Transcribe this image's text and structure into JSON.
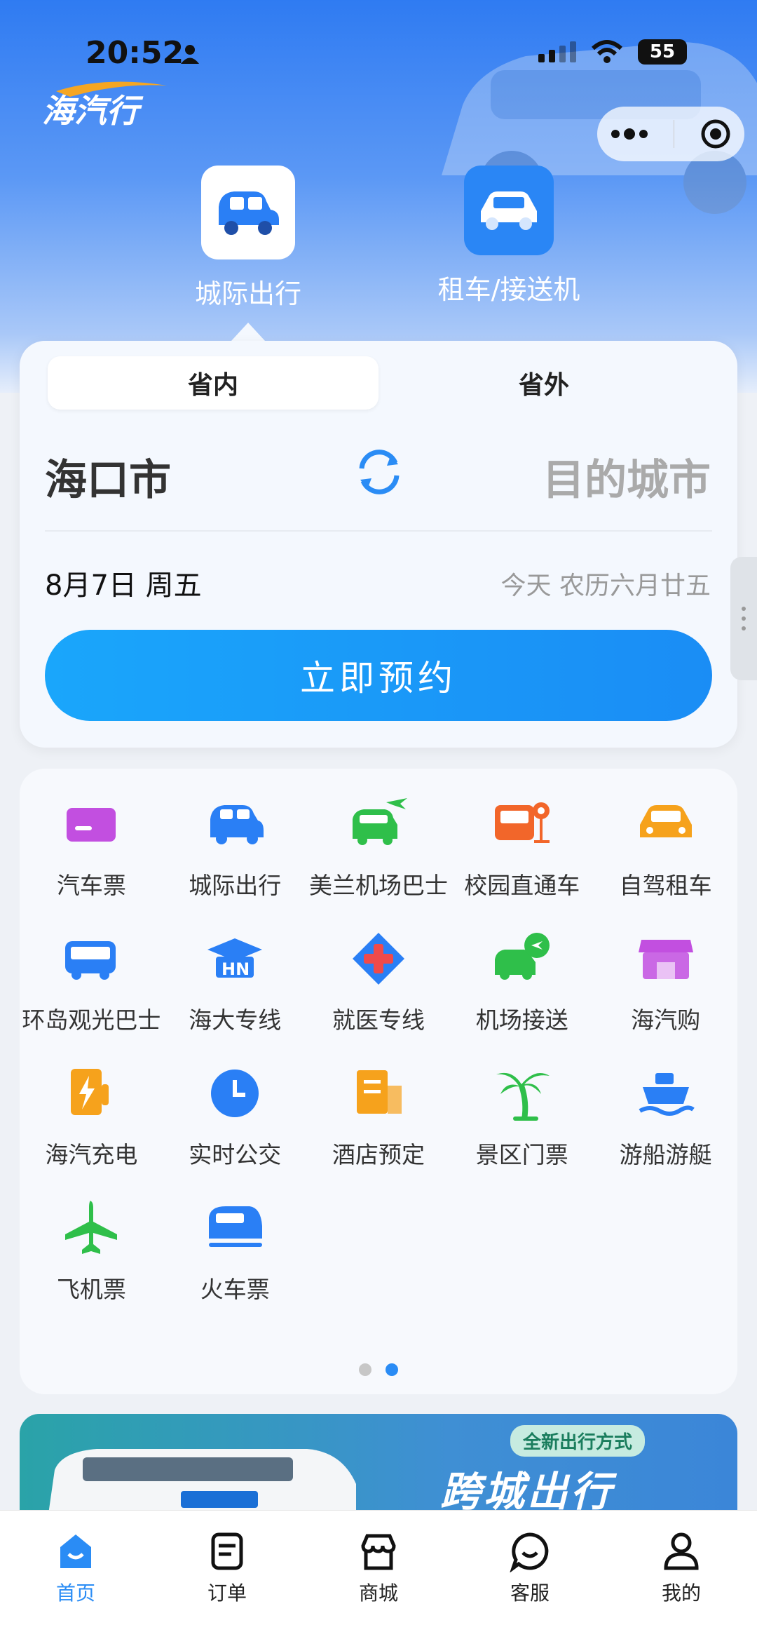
{
  "status_bar": {
    "time": "20:52",
    "battery": "55"
  },
  "app": {
    "logo_text": "海汽行"
  },
  "top_tabs": [
    {
      "label": "城际出行",
      "active": true
    },
    {
      "label": "租车/接送机",
      "active": false
    }
  ],
  "booking": {
    "segments": [
      "省内",
      "省外"
    ],
    "from_city": "海口市",
    "to_city": "目的城市",
    "date": "8月7日 周五",
    "lunar": "今天 农历六月廿五",
    "book_button": "立即预约"
  },
  "services": [
    {
      "label": "汽车票",
      "icon": "ticket-card-icon",
      "color": "#c24fe0"
    },
    {
      "label": "城际出行",
      "icon": "intercity-car-icon",
      "color": "#2a7ff5"
    },
    {
      "label": "美兰机场巴士",
      "icon": "airport-bus-icon",
      "color": "#2fbf4a"
    },
    {
      "label": "校园直通车",
      "icon": "campus-bus-icon",
      "color": "#f2662a"
    },
    {
      "label": "自驾租车",
      "icon": "rental-car-icon",
      "color": "#f6a21c"
    },
    {
      "label": "环岛观光巴士",
      "icon": "sightseeing-bus-icon",
      "color": "#2a7ff5"
    },
    {
      "label": "海大专线",
      "icon": "graduation-cap-icon",
      "color": "#2a7ff5"
    },
    {
      "label": "就医专线",
      "icon": "medical-cross-icon",
      "color": "#2a7ff5"
    },
    {
      "label": "机场接送",
      "icon": "airport-transfer-icon",
      "color": "#2fbf4a"
    },
    {
      "label": "海汽购",
      "icon": "shop-store-icon",
      "color": "#c24fe0"
    },
    {
      "label": "海汽充电",
      "icon": "charging-icon",
      "color": "#f6a21c"
    },
    {
      "label": "实时公交",
      "icon": "realtime-clock-icon",
      "color": "#2a7ff5"
    },
    {
      "label": "酒店预定",
      "icon": "hotel-building-icon",
      "color": "#f6a21c"
    },
    {
      "label": "景区门票",
      "icon": "palm-tree-icon",
      "color": "#2fbf4a"
    },
    {
      "label": "游船游艇",
      "icon": "cruise-ship-icon",
      "color": "#2a7ff5"
    },
    {
      "label": "飞机票",
      "icon": "airplane-icon",
      "color": "#2fbf4a"
    },
    {
      "label": "火车票",
      "icon": "train-icon",
      "color": "#2a7ff5"
    }
  ],
  "pager": {
    "pages": 2,
    "active": 2
  },
  "banner": {
    "tag": "全新出行方式",
    "title": "跨城出行"
  },
  "tabbar": [
    {
      "label": "首页",
      "icon": "home-icon",
      "active": true
    },
    {
      "label": "订单",
      "icon": "order-icon",
      "active": false
    },
    {
      "label": "商城",
      "icon": "store-icon",
      "active": false
    },
    {
      "label": "客服",
      "icon": "chat-service-icon",
      "active": false
    },
    {
      "label": "我的",
      "icon": "profile-icon",
      "active": false
    }
  ]
}
